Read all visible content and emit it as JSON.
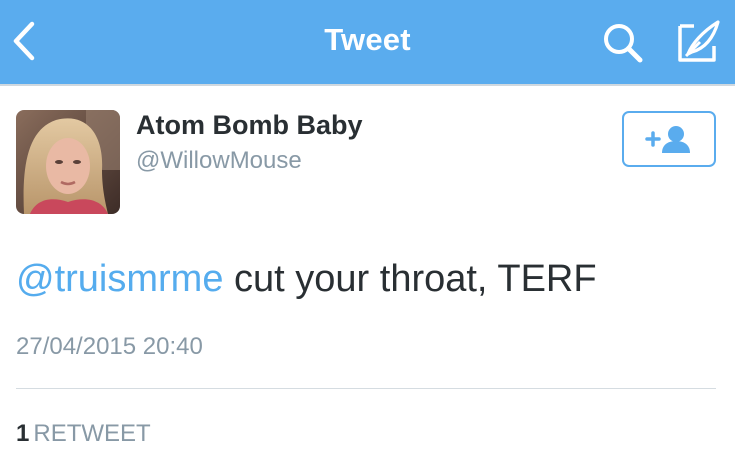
{
  "header": {
    "title": "Tweet",
    "background": "#5aacee",
    "back_icon": "chevron-left-icon",
    "search_icon": "search-icon",
    "compose_icon": "compose-icon"
  },
  "author": {
    "display_name": "Atom Bomb Baby",
    "handle": "@WillowMouse",
    "follow_icon": "add-user-icon"
  },
  "tweet": {
    "mention": "@truismrme",
    "text": " cut your throat, TERF",
    "timestamp": "27/04/2015 20:40"
  },
  "stats": {
    "retweet_count": "1",
    "retweet_label": "RETWEET"
  },
  "colors": {
    "accent": "#55acee",
    "text": "#292f33",
    "muted": "#8899a6"
  }
}
